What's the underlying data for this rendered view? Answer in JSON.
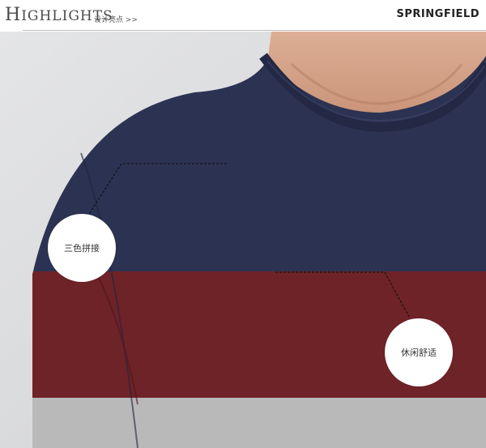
{
  "header": {
    "title_first": "H",
    "title_rest": "IGHLIGHTS",
    "subtitle": "设计亮点 >>",
    "brand": "SPRINGFIELD"
  },
  "callouts": [
    {
      "label": "三色拼接"
    },
    {
      "label": "休闲舒适"
    }
  ],
  "colors": {
    "navy": "#2c3352",
    "maroon": "#6e2328",
    "gray_stripe": "#b9b9b9",
    "skin": "#e2b49c",
    "background": "#d7d8da"
  }
}
